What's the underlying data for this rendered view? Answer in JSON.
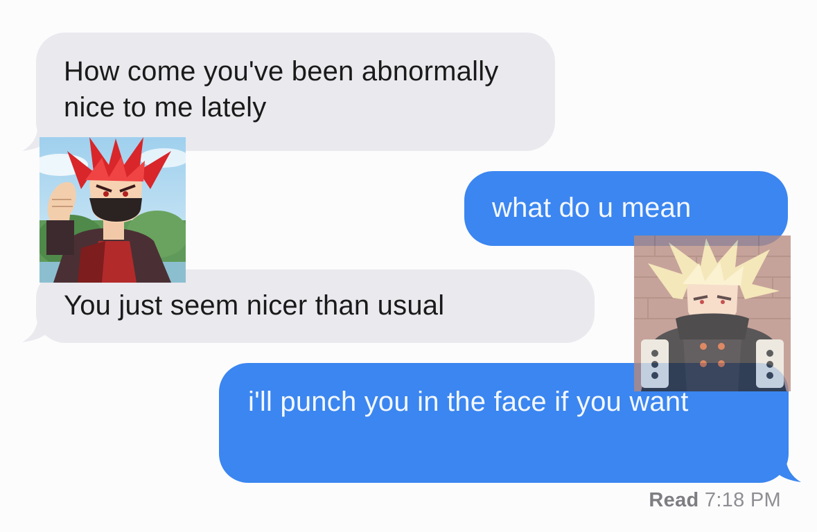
{
  "conversation": {
    "messages": [
      {
        "direction": "incoming",
        "text": "How come you've been abnormally nice to me lately"
      },
      {
        "direction": "outgoing",
        "text": "what do u mean"
      },
      {
        "direction": "incoming",
        "text": "You just seem nicer than usual"
      },
      {
        "direction": "outgoing",
        "text": "i'll punch you in the face if you want"
      }
    ],
    "read_receipt": {
      "label": "Read",
      "time": "7:18 PM"
    }
  },
  "stickers": [
    {
      "icon": "red-spiky-hair-character-avatar-icon"
    },
    {
      "icon": "blond-spiky-hair-character-avatar-icon"
    }
  ],
  "colors": {
    "incoming_bubble": "#e9e9ee",
    "outgoing_bubble": "#3b86f0",
    "outgoing_text": "#f4f8ff",
    "receipt_text": "#8e8e93"
  }
}
